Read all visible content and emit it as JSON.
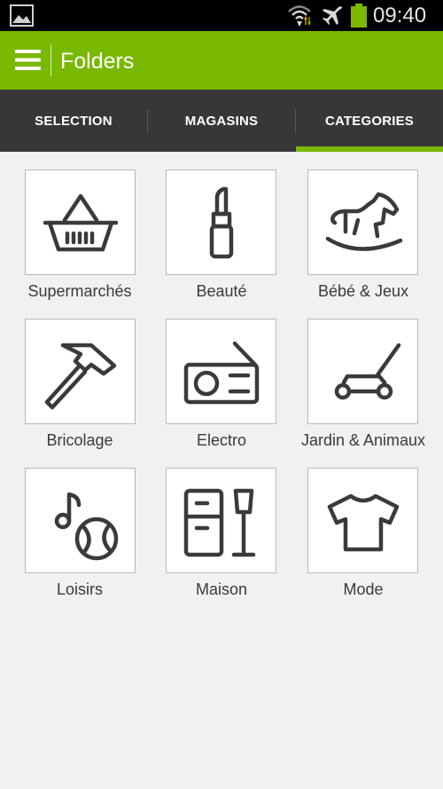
{
  "status_bar": {
    "time": "09:40",
    "icons": [
      "gallery-icon",
      "wifi-icon",
      "airplane-icon",
      "battery-icon"
    ],
    "battery_color": "#7ab801"
  },
  "app_bar": {
    "title": "Folders",
    "menu_icon": "hamburger-menu-icon",
    "color": "#7ab801"
  },
  "tabs": [
    {
      "label": "SELECTION",
      "selected": false
    },
    {
      "label": "MAGASINS",
      "selected": false
    },
    {
      "label": "CATEGORIES",
      "selected": true
    }
  ],
  "categories": [
    {
      "label": "Supermarchés",
      "icon": "basket-icon"
    },
    {
      "label": "Beauté",
      "icon": "lipstick-icon"
    },
    {
      "label": "Bébé & Jeux",
      "icon": "rocking-horse-icon"
    },
    {
      "label": "Bricolage",
      "icon": "hammer-icon"
    },
    {
      "label": "Electro",
      "icon": "radio-icon"
    },
    {
      "label": "Jardin & Animaux",
      "icon": "lawn-mower-icon"
    },
    {
      "label": "Loisirs",
      "icon": "music-ball-icon"
    },
    {
      "label": "Maison",
      "icon": "fridge-lamp-icon"
    },
    {
      "label": "Mode",
      "icon": "tshirt-icon"
    }
  ],
  "colors": {
    "accent": "#7ab801",
    "tab_bar": "#373737",
    "icon_stroke": "#3a3a3a"
  }
}
